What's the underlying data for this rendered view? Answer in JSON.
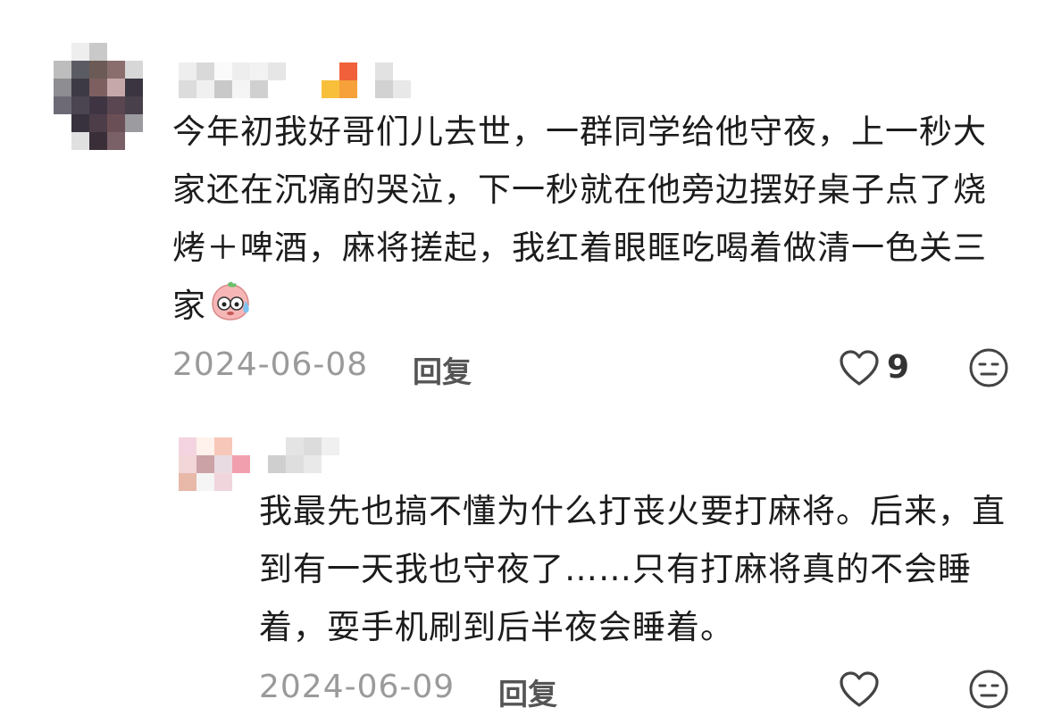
{
  "comments": [
    {
      "text": "今年初我好哥们儿去世，一群同学给他守夜，上一秒大家还在沉痛的哭泣，下一秒就在他旁边摆好桌子点了烧烤＋啤酒，麻将搓起，我红着眼眶吃喝着做清一色关三家",
      "emoji_icon": "sweating-face-emoji-icon",
      "date": "2024-06-08",
      "reply_label": "回复",
      "like_count": "9",
      "like_icon": "heart-outline-icon",
      "dislike_icon": "unamused-face-outline-icon",
      "avatar_blurred": true,
      "username_blurred": true
    },
    {
      "text": "我最先也搞不懂为什么打丧火要打麻将。后来，直到有一天我也守夜了……只有打麻将真的不会睡着，耍手机刷到后半夜会睡着。",
      "date": "2024-06-09",
      "reply_label": "回复",
      "like_icon": "heart-outline-icon",
      "dislike_icon": "unamused-face-outline-icon",
      "avatar_blurred": true,
      "username_blurred": true
    }
  ],
  "colors": {
    "text": "#1c1c1c",
    "meta": "#9a9a9a",
    "reply": "#555555",
    "icon_stroke": "#444444"
  }
}
